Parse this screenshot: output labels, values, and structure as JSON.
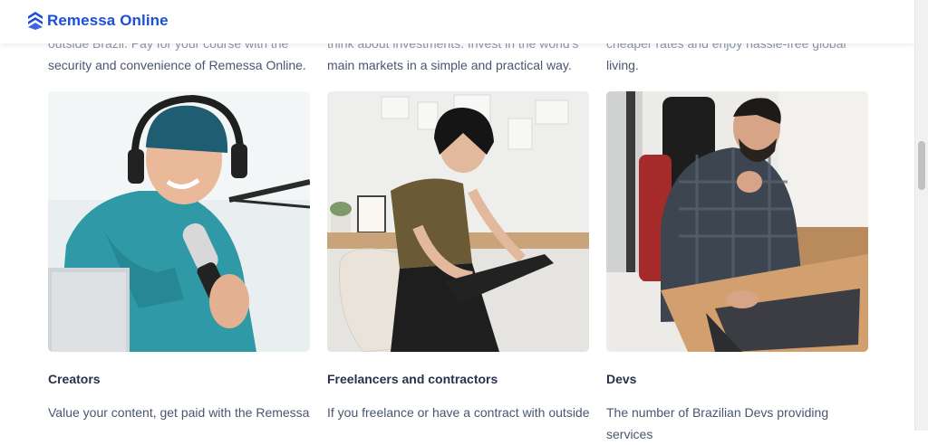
{
  "brand": {
    "name": "Remessa Online",
    "color": "#1b4fd6"
  },
  "columns": [
    {
      "top_text_line1": "outside Brazil. Pay for your course with the",
      "top_text_line2": "security and convenience of Remessa Online.",
      "image_icon": "creator-podcast-photo",
      "title": "Creators",
      "description": "Value your content, get paid with the Remessa"
    },
    {
      "top_text_line1": "think about investments. Invest in the world's",
      "top_text_line2": "main markets in a simple and practical way.",
      "image_icon": "freelancer-drawing-photo",
      "title": "Freelancers and contractors",
      "description": "If you freelance or have a contract with outside"
    },
    {
      "top_text_line1": "cheaper rates and enjoy hassle-free global",
      "top_text_line2": "living.",
      "image_icon": "developer-laptop-photo",
      "title": "Devs",
      "description": "The number of Brazilian Devs providing services"
    }
  ]
}
